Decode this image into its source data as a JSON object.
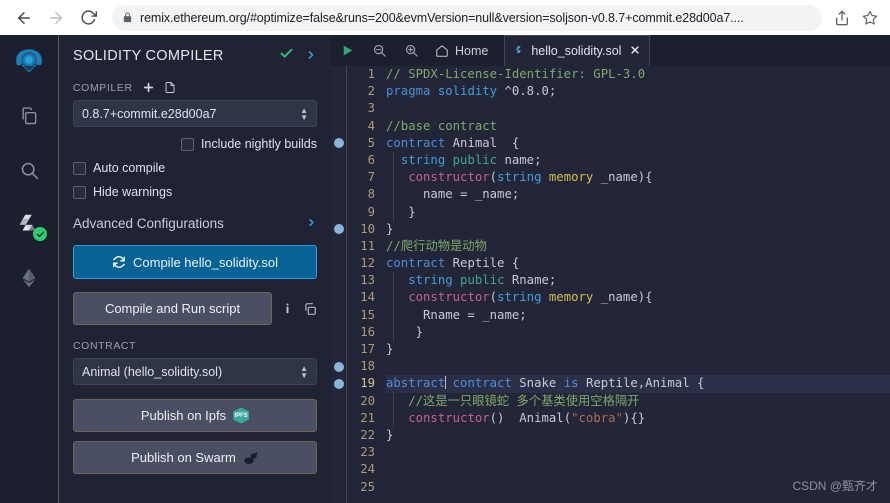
{
  "browser": {
    "back_icon": "back-arrow-icon",
    "forward_icon": "forward-arrow-icon",
    "reload_icon": "reload-icon",
    "lock_icon": "lock-icon",
    "url": "remix.ethereum.org/#optimize=false&runs=200&evmVersion=null&version=soljson-v0.8.7+commit.e28d00a7....",
    "share_icon": "share-icon",
    "bookmark_icon": "star-icon"
  },
  "rail": {
    "items": [
      {
        "name": "remix-logo-icon",
        "label": "Remix"
      },
      {
        "name": "file-explorer-icon",
        "label": "File explorers"
      },
      {
        "name": "search-icon",
        "label": "Search in files"
      },
      {
        "name": "solidity-compiler-icon",
        "label": "Solidity compiler"
      },
      {
        "name": "deploy-run-icon",
        "label": "Deploy & run transactions"
      }
    ]
  },
  "panel": {
    "title": "SOLIDITY COMPILER",
    "check_icon": "check-icon",
    "chevron_icon": "chevron-right-icon",
    "compiler_label": "COMPILER",
    "add_icon": "plus-icon",
    "file_icon": "document-icon",
    "compiler_version": "0.8.7+commit.e28d00a7",
    "nightly_label": "Include nightly builds",
    "auto_compile_label": "Auto compile",
    "hide_warnings_label": "Hide warnings",
    "advanced_label": "Advanced Configurations",
    "advanced_chevron": "chevron-right-icon",
    "compile_icon": "refresh-icon",
    "compile_label": "Compile hello_solidity.sol",
    "run_script_label": "Compile and Run script",
    "info_icon": "info-icon",
    "copy_icon": "copy-icon",
    "contract_label": "CONTRACT",
    "contract_value": "Animal (hello_solidity.sol)",
    "publish_ipfs_label": "Publish on Ipfs",
    "ipfs_badge": "IPFS",
    "publish_swarm_label": "Publish on Swarm",
    "swarm_icon": "swarm-icon"
  },
  "tabs": {
    "run_icon": "play-icon",
    "zoom_out_icon": "zoom-out-icon",
    "zoom_in_icon": "zoom-in-icon",
    "home_icon": "home-icon",
    "home_label": "Home",
    "file_glyph": "solidity-icon",
    "file_label": "hello_solidity.sol",
    "close_icon": "close-icon"
  },
  "editor": {
    "active_line": 19,
    "breakpoint_lines": [
      5,
      10,
      18,
      19
    ],
    "lines": [
      {
        "n": 1,
        "tokens": [
          {
            "t": "// SPDX-License-Identifier: GPL-3.0",
            "c": "c-cmt"
          }
        ]
      },
      {
        "n": 2,
        "tokens": [
          {
            "t": "pragma",
            "c": "c-kw"
          },
          {
            "t": " ",
            "c": ""
          },
          {
            "t": "solidity",
            "c": "c-key2"
          },
          {
            "t": " ^0.8.0;",
            "c": "c-num"
          }
        ]
      },
      {
        "n": 3,
        "tokens": []
      },
      {
        "n": 4,
        "tokens": [
          {
            "t": "//base contract",
            "c": "c-cmt"
          }
        ]
      },
      {
        "n": 5,
        "tokens": [
          {
            "t": "contract",
            "c": "c-kw"
          },
          {
            "t": " ",
            "c": ""
          },
          {
            "t": "Animal",
            "c": "c-id"
          },
          {
            "t": "  {",
            "c": "c-name"
          }
        ]
      },
      {
        "n": 6,
        "tokens": [
          {
            "t": "  ",
            "c": ""
          },
          {
            "t": "string",
            "c": "c-type"
          },
          {
            "t": " ",
            "c": ""
          },
          {
            "t": "public",
            "c": "c-pub"
          },
          {
            "t": " name;",
            "c": "c-name"
          }
        ]
      },
      {
        "n": 7,
        "tokens": [
          {
            "t": "   ",
            "c": ""
          },
          {
            "t": "constructor",
            "c": "c-ctor"
          },
          {
            "t": "(",
            "c": "c-name"
          },
          {
            "t": "string",
            "c": "c-type"
          },
          {
            "t": " ",
            "c": ""
          },
          {
            "t": "memory",
            "c": "c-mem"
          },
          {
            "t": " _name){",
            "c": "c-name"
          }
        ]
      },
      {
        "n": 8,
        "tokens": [
          {
            "t": "     name = _name;",
            "c": "c-name"
          }
        ]
      },
      {
        "n": 9,
        "tokens": [
          {
            "t": "   }",
            "c": "c-name"
          }
        ]
      },
      {
        "n": 10,
        "tokens": [
          {
            "t": "}",
            "c": "c-name"
          }
        ]
      },
      {
        "n": 11,
        "tokens": [
          {
            "t": "//爬行动物是动物",
            "c": "c-cmt"
          }
        ]
      },
      {
        "n": 12,
        "tokens": [
          {
            "t": "contract",
            "c": "c-kw"
          },
          {
            "t": " ",
            "c": ""
          },
          {
            "t": "Reptile",
            "c": "c-id"
          },
          {
            "t": " {",
            "c": "c-name"
          }
        ]
      },
      {
        "n": 13,
        "tokens": [
          {
            "t": "   ",
            "c": ""
          },
          {
            "t": "string",
            "c": "c-type"
          },
          {
            "t": " ",
            "c": ""
          },
          {
            "t": "public",
            "c": "c-pub"
          },
          {
            "t": " Rname;",
            "c": "c-name"
          }
        ]
      },
      {
        "n": 14,
        "tokens": [
          {
            "t": "   ",
            "c": ""
          },
          {
            "t": "constructor",
            "c": "c-ctor"
          },
          {
            "t": "(",
            "c": "c-name"
          },
          {
            "t": "string",
            "c": "c-type"
          },
          {
            "t": " ",
            "c": ""
          },
          {
            "t": "memory",
            "c": "c-mem"
          },
          {
            "t": " _name){",
            "c": "c-name"
          }
        ]
      },
      {
        "n": 15,
        "tokens": [
          {
            "t": "     Rname = _name;",
            "c": "c-name"
          }
        ]
      },
      {
        "n": 16,
        "tokens": [
          {
            "t": "    }",
            "c": "c-name"
          }
        ]
      },
      {
        "n": 17,
        "tokens": [
          {
            "t": "}",
            "c": "c-name"
          }
        ]
      },
      {
        "n": 18,
        "tokens": []
      },
      {
        "n": 19,
        "tokens": [
          {
            "t": "abstract",
            "c": "c-abs"
          },
          {
            "t": "\u0000",
            "c": "cursor"
          },
          {
            "t": " ",
            "c": ""
          },
          {
            "t": "contract",
            "c": "c-kw"
          },
          {
            "t": " ",
            "c": ""
          },
          {
            "t": "Snake",
            "c": "c-id"
          },
          {
            "t": " ",
            "c": ""
          },
          {
            "t": "is",
            "c": "c-kw"
          },
          {
            "t": " ",
            "c": ""
          },
          {
            "t": "Reptile",
            "c": "c-id"
          },
          {
            "t": ",",
            "c": "c-name"
          },
          {
            "t": "Animal",
            "c": "c-id"
          },
          {
            "t": " {",
            "c": "c-name"
          }
        ]
      },
      {
        "n": 20,
        "tokens": [
          {
            "t": "   ",
            "c": ""
          },
          {
            "t": "//这是一只眼镜蛇 多个基类使用空格隔开",
            "c": "c-cmt"
          }
        ]
      },
      {
        "n": 21,
        "tokens": [
          {
            "t": "   ",
            "c": ""
          },
          {
            "t": "constructor",
            "c": "c-ctor"
          },
          {
            "t": "()  ",
            "c": "c-name"
          },
          {
            "t": "Animal",
            "c": "c-id"
          },
          {
            "t": "(",
            "c": "c-name"
          },
          {
            "t": "\"cobra\"",
            "c": "c-str"
          },
          {
            "t": "){}",
            "c": "c-name"
          }
        ]
      },
      {
        "n": 22,
        "tokens": [
          {
            "t": "}",
            "c": "c-name"
          }
        ]
      },
      {
        "n": 23,
        "tokens": []
      },
      {
        "n": 24,
        "tokens": []
      },
      {
        "n": 25,
        "tokens": []
      }
    ]
  },
  "watermark": "CSDN @甄齐才"
}
